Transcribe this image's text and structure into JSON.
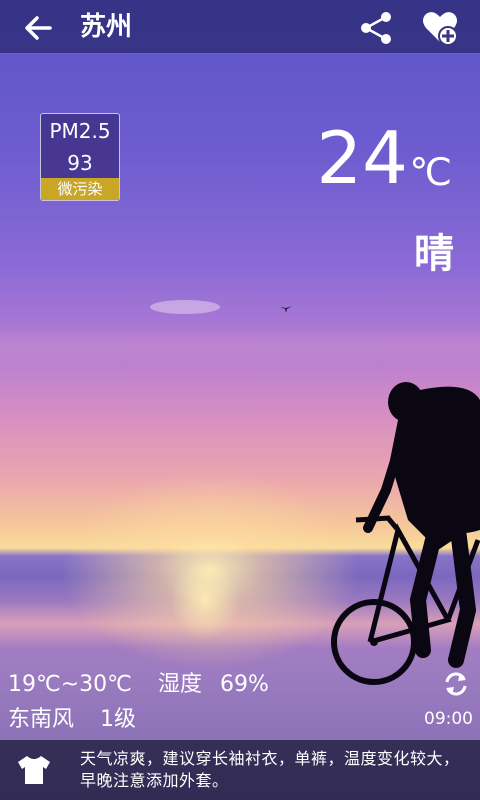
{
  "header": {
    "city": "苏州",
    "back_icon": "arrow-left-icon",
    "share_icon": "share-icon",
    "favorite_icon": "heart-plus-icon"
  },
  "air_quality": {
    "label": "PM2.5",
    "value": "93",
    "level": "微污染",
    "level_color": "#c9a626"
  },
  "current": {
    "temperature": "24",
    "unit": "℃",
    "condition": "晴"
  },
  "details": {
    "temp_range": "19℃~30℃",
    "humidity_label": "湿度",
    "humidity_value": "69%",
    "wind_direction": "东南风",
    "wind_level": "1级",
    "update_time": "09:00",
    "refresh_icon": "refresh-icon"
  },
  "advice": {
    "icon": "shirt-icon",
    "text": "天气凉爽，建议穿长袖衬衣，单裤，温度变化较大，早晚注意添加外套。"
  },
  "colors": {
    "topbar": "#282870",
    "sky_top": "#5c53c8",
    "horizon": "#f9dc9b"
  }
}
